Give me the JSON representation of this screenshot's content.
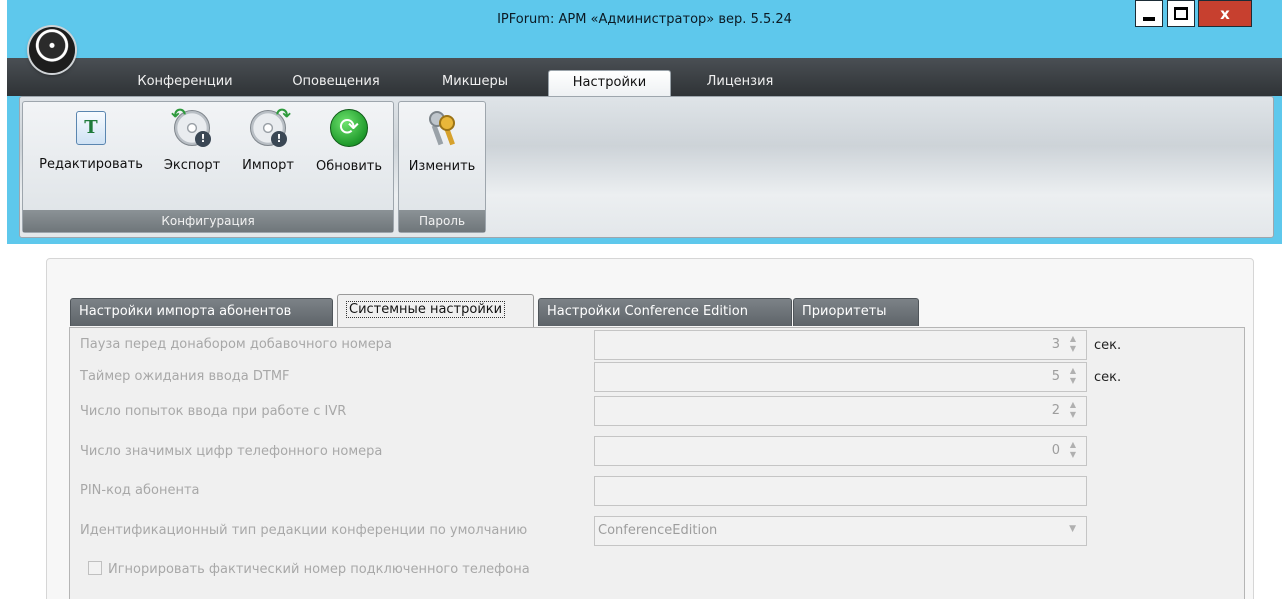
{
  "window": {
    "title": "IPForum: АРМ «Администратор» вер. 5.5.24",
    "controls": {
      "minimize": "minimize",
      "maximize": "maximize",
      "close": "x"
    }
  },
  "menu_tabs": [
    {
      "label": "Конференции",
      "active": false
    },
    {
      "label": "Оповещения",
      "active": false
    },
    {
      "label": "Микшеры",
      "active": false
    },
    {
      "label": "Настройки",
      "active": true
    },
    {
      "label": "Лицензия",
      "active": false
    }
  ],
  "ribbon": {
    "configuration": {
      "caption": "Конфигурация",
      "buttons": [
        {
          "label": "Редактировать",
          "icon": "edit-text-icon"
        },
        {
          "label": "Экспорт",
          "icon": "export-disc-icon"
        },
        {
          "label": "Импорт",
          "icon": "import-disc-icon"
        },
        {
          "label": "Обновить",
          "icon": "refresh-icon"
        }
      ]
    },
    "password": {
      "caption": "Пароль",
      "buttons": [
        {
          "label": "Изменить",
          "icon": "keys-icon"
        }
      ]
    }
  },
  "settings_tabs": [
    {
      "label": "Настройки импорта абонентов",
      "active": false
    },
    {
      "label": "Системные настройки",
      "active": true
    },
    {
      "label": "Настройки Conference Edition",
      "active": false
    },
    {
      "label": "Приоритеты",
      "active": false
    }
  ],
  "system_settings": {
    "rows": [
      {
        "label": "Пауза перед донабором добавочного номера",
        "value": "3",
        "unit": "сек."
      },
      {
        "label": "Таймер ожидания ввода DTMF",
        "value": "5",
        "unit": "сек."
      },
      {
        "label": "Число попыток ввода при работе с IVR",
        "value": "2"
      },
      {
        "label": "Число значимых цифр телефонного номера",
        "value": "0"
      }
    ],
    "pin": {
      "label": "PIN-код абонента",
      "value": ""
    },
    "conference_type": {
      "label": "Идентификационный тип редакции конференции по умолчанию",
      "selected": "ConferenceEdition"
    },
    "ignore_phone": {
      "label": "Игнорировать фактический номер подключенного телефона",
      "checked": false
    }
  },
  "colors": {
    "title_bar": "#5ec8ec",
    "menu_bar": "#3a3f43",
    "close_button": "#c7402f",
    "disabled_text": "#a8a8a8"
  }
}
